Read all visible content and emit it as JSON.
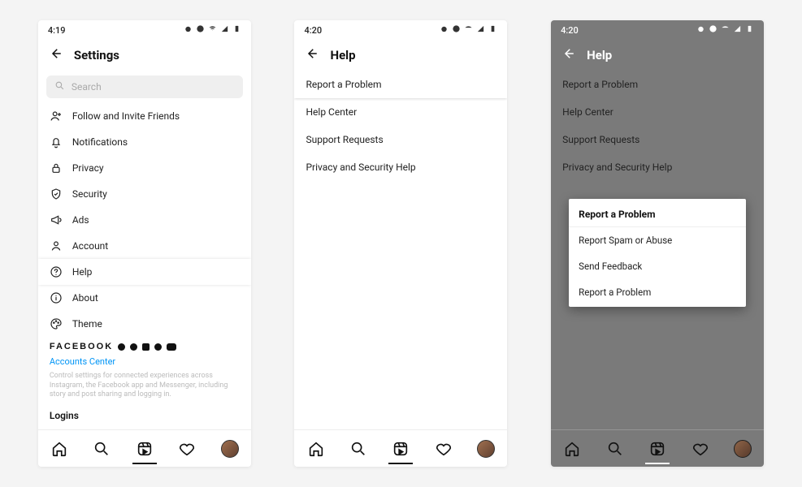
{
  "screen1": {
    "time": "4:19",
    "title": "Settings",
    "search_placeholder": "Search",
    "items": {
      "follow": "Follow and Invite Friends",
      "notifications": "Notifications",
      "privacy": "Privacy",
      "security": "Security",
      "ads": "Ads",
      "account": "Account",
      "help": "Help",
      "about": "About",
      "theme": "Theme"
    },
    "facebook_label": "FACEBOOK",
    "accounts_center": "Accounts Center",
    "accounts_center_desc": "Control settings for connected experiences across Instagram, the Facebook app and Messenger, including story and post sharing and logging in.",
    "logins_header": "Logins"
  },
  "screen2": {
    "time": "4:20",
    "title": "Help",
    "items": {
      "report": "Report a Problem",
      "help_center": "Help Center",
      "support": "Support Requests",
      "privsec": "Privacy and Security Help"
    }
  },
  "screen3": {
    "time": "4:20",
    "title": "Help",
    "items": {
      "report": "Report a Problem",
      "help_center": "Help Center",
      "support": "Support Requests",
      "privsec": "Privacy and Security Help"
    },
    "dialog": {
      "title": "Report a Problem",
      "opt1": "Report Spam or Abuse",
      "opt2": "Send Feedback",
      "opt3": "Report a Problem"
    }
  }
}
